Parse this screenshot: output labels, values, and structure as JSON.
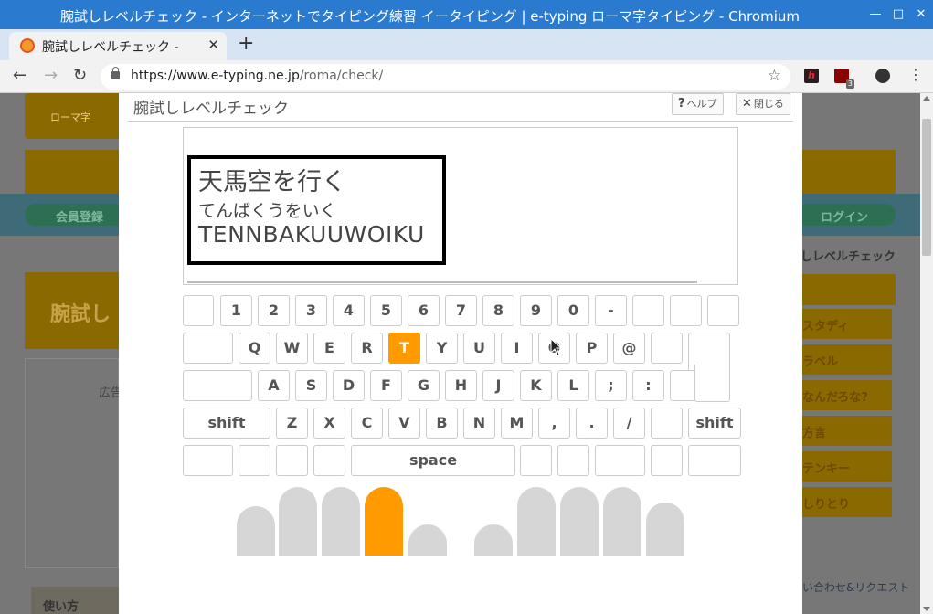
{
  "browser": {
    "window_title": "腕試しレベルチェック - インターネットでタイピング練習 イータイピング | e-typing ローマ字タイピング - Chromium",
    "tab_title": "腕試しレベルチェック -",
    "url_domain": "https://www.e-typing.ne.jp",
    "url_path": "/roma/check/",
    "extension_badge": "3"
  },
  "background_page": {
    "member_register": "会員登録",
    "login": "ログイン",
    "heading": "腕試し",
    "ad": "広告",
    "level_check": "しレベルチェック",
    "sidebar": [
      "スタディ",
      "ラベル",
      "なんだろな?",
      "方言",
      "テンキー",
      "しりとり"
    ],
    "contact": "い合わせ&リクエスト",
    "howto": "使い方",
    "romaji_logo": "ローマ字"
  },
  "modal": {
    "title": "腕試しレベルチェック",
    "help_label": "ヘルプ",
    "close_label": "閉じる",
    "word": {
      "kanji": "天馬空を行く",
      "kana": "てんばくうをいく",
      "romaji": "TENNBAKUUWOIKU"
    },
    "keyboard": {
      "row1": [
        "",
        "1",
        "2",
        "3",
        "4",
        "5",
        "6",
        "7",
        "8",
        "9",
        "0",
        "-",
        "",
        "",
        ""
      ],
      "row2": [
        "",
        "Q",
        "W",
        "E",
        "R",
        "T",
        "Y",
        "U",
        "I",
        "O",
        "P",
        "@",
        "",
        ""
      ],
      "row3": [
        "",
        "A",
        "S",
        "D",
        "F",
        "G",
        "H",
        "J",
        "K",
        "L",
        ";",
        ":",
        ""
      ],
      "row4": [
        "shift",
        "Z",
        "X",
        "C",
        "V",
        "B",
        "N",
        "M",
        ",",
        ".",
        "/",
        "",
        "shift"
      ],
      "row5": [
        "",
        "",
        "",
        "",
        "space",
        "",
        "",
        "",
        "",
        ""
      ],
      "highlighted_key": "T"
    },
    "fingers": {
      "highlighted": "left-index"
    }
  },
  "colors": {
    "highlight": "#ff9a00",
    "titlebar": "#2a7ad0"
  }
}
